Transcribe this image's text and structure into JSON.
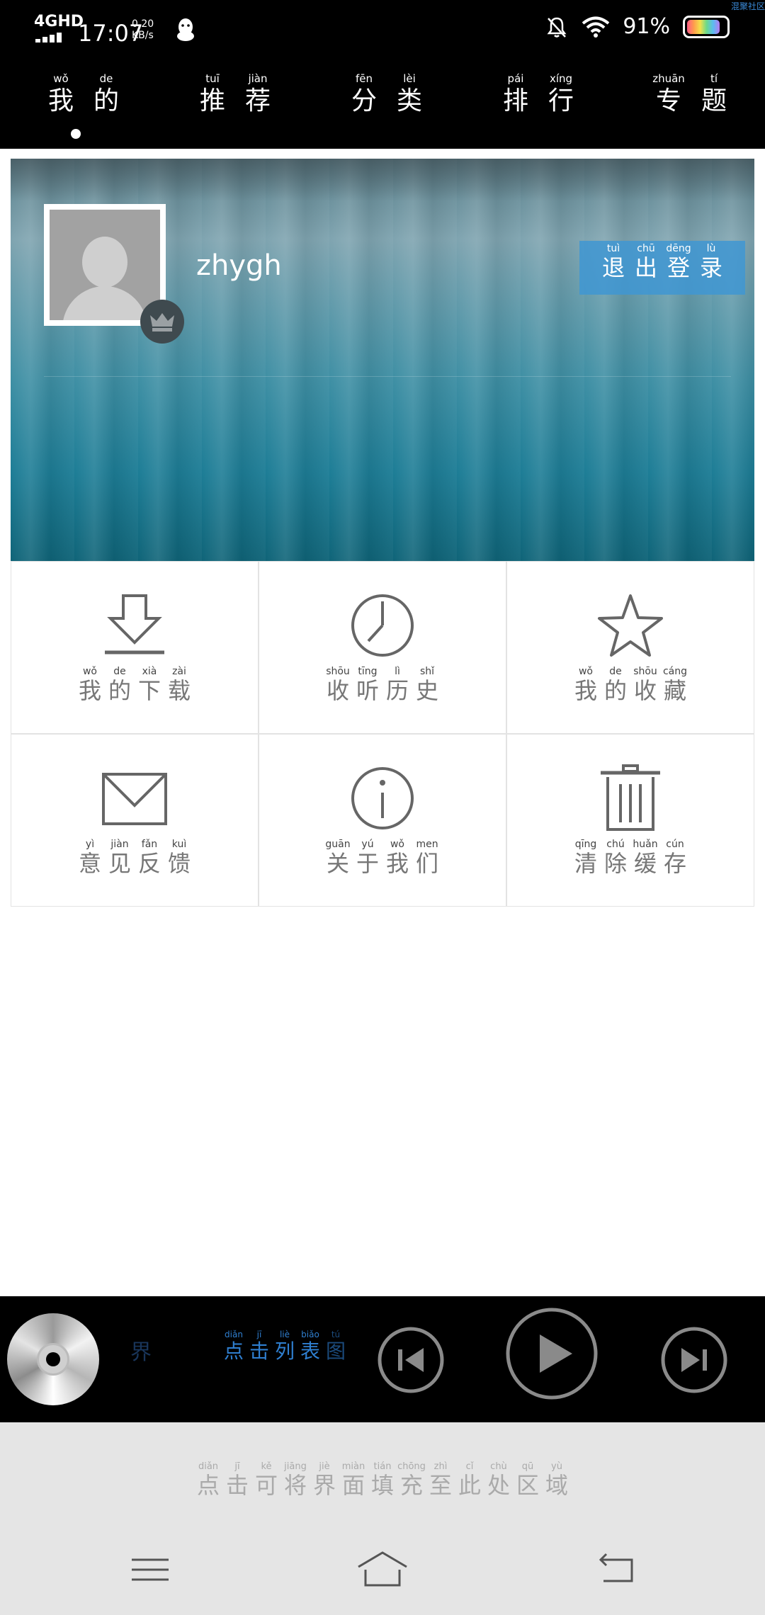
{
  "status_bar": {
    "network": "4GHD",
    "time": "17:07",
    "speed_value": "0.20",
    "speed_unit": "KB/s",
    "battery_percent": "91%",
    "battery_level": 0.91,
    "corner_tag": "混聚社区"
  },
  "nav": {
    "tabs": [
      {
        "key": "mine",
        "chars": [
          {
            "py": "wǒ",
            "hz": "我"
          },
          {
            "py": "de",
            "hz": "的"
          }
        ]
      },
      {
        "key": "recommend",
        "chars": [
          {
            "py": "tuī",
            "hz": "推"
          },
          {
            "py": "jiàn",
            "hz": "荐"
          }
        ]
      },
      {
        "key": "category",
        "chars": [
          {
            "py": "fēn",
            "hz": "分"
          },
          {
            "py": "lèi",
            "hz": "类"
          }
        ]
      },
      {
        "key": "ranking",
        "chars": [
          {
            "py": "pái",
            "hz": "排"
          },
          {
            "py": "xíng",
            "hz": "行"
          }
        ]
      },
      {
        "key": "topics",
        "chars": [
          {
            "py": "zhuān",
            "hz": "专"
          },
          {
            "py": "tí",
            "hz": "题"
          }
        ]
      }
    ],
    "selected_index": 0
  },
  "profile": {
    "username": "zhygh",
    "logout": [
      {
        "py": "tuì",
        "hz": "退"
      },
      {
        "py": "chū",
        "hz": "出"
      },
      {
        "py": "dēng",
        "hz": "登"
      },
      {
        "py": "lù",
        "hz": "录"
      }
    ]
  },
  "grid": [
    {
      "key": "downloads",
      "icon": "download-icon",
      "chars": [
        {
          "py": "wǒ",
          "hz": "我"
        },
        {
          "py": "de",
          "hz": "的"
        },
        {
          "py": "xià",
          "hz": "下"
        },
        {
          "py": "zài",
          "hz": "载"
        }
      ]
    },
    {
      "key": "history",
      "icon": "clock-icon",
      "chars": [
        {
          "py": "shōu",
          "hz": "收"
        },
        {
          "py": "tīng",
          "hz": "听"
        },
        {
          "py": "lì",
          "hz": "历"
        },
        {
          "py": "shǐ",
          "hz": "史"
        }
      ]
    },
    {
      "key": "favorites",
      "icon": "star-icon",
      "chars": [
        {
          "py": "wǒ",
          "hz": "我"
        },
        {
          "py": "de",
          "hz": "的"
        },
        {
          "py": "shōu",
          "hz": "收"
        },
        {
          "py": "cáng",
          "hz": "藏"
        }
      ]
    },
    {
      "key": "feedback",
      "icon": "mail-icon",
      "chars": [
        {
          "py": "yì",
          "hz": "意"
        },
        {
          "py": "jiàn",
          "hz": "见"
        },
        {
          "py": "fǎn",
          "hz": "反"
        },
        {
          "py": "kuì",
          "hz": "馈"
        }
      ]
    },
    {
      "key": "about",
      "icon": "info-icon",
      "chars": [
        {
          "py": "guān",
          "hz": "关"
        },
        {
          "py": "yú",
          "hz": "于"
        },
        {
          "py": "wǒ",
          "hz": "我"
        },
        {
          "py": "men",
          "hz": "们"
        }
      ]
    },
    {
      "key": "clear-cache",
      "icon": "trash-icon",
      "chars": [
        {
          "py": "qīng",
          "hz": "清"
        },
        {
          "py": "chú",
          "hz": "除"
        },
        {
          "py": "huǎn",
          "hz": "缓"
        },
        {
          "py": "cún",
          "hz": "存"
        }
      ]
    }
  ],
  "player": {
    "fragment": "界",
    "marquee": [
      {
        "py": "diǎn",
        "hz": "点"
      },
      {
        "py": "jī",
        "hz": "击"
      },
      {
        "py": "liè",
        "hz": "列"
      },
      {
        "py": "biǎo",
        "hz": "表"
      },
      {
        "py": "tú",
        "hz": "图"
      }
    ],
    "icons": [
      "cd-disc-icon",
      "previous-icon",
      "play-icon",
      "next-icon"
    ]
  },
  "hint": [
    {
      "py": "diǎn",
      "hz": "点"
    },
    {
      "py": "jī",
      "hz": "击"
    },
    {
      "py": "kě",
      "hz": "可"
    },
    {
      "py": "jiāng",
      "hz": "将"
    },
    {
      "py": "jiè",
      "hz": "界"
    },
    {
      "py": "miàn",
      "hz": "面"
    },
    {
      "py": "tián",
      "hz": "填"
    },
    {
      "py": "chōng",
      "hz": "充"
    },
    {
      "py": "zhì",
      "hz": "至"
    },
    {
      "py": "cǐ",
      "hz": "此"
    },
    {
      "py": "chù",
      "hz": "处"
    },
    {
      "py": "qū",
      "hz": "区"
    },
    {
      "py": "yù",
      "hz": "域"
    }
  ],
  "system_nav_icons": [
    "menu-icon",
    "home-icon",
    "back-icon"
  ]
}
